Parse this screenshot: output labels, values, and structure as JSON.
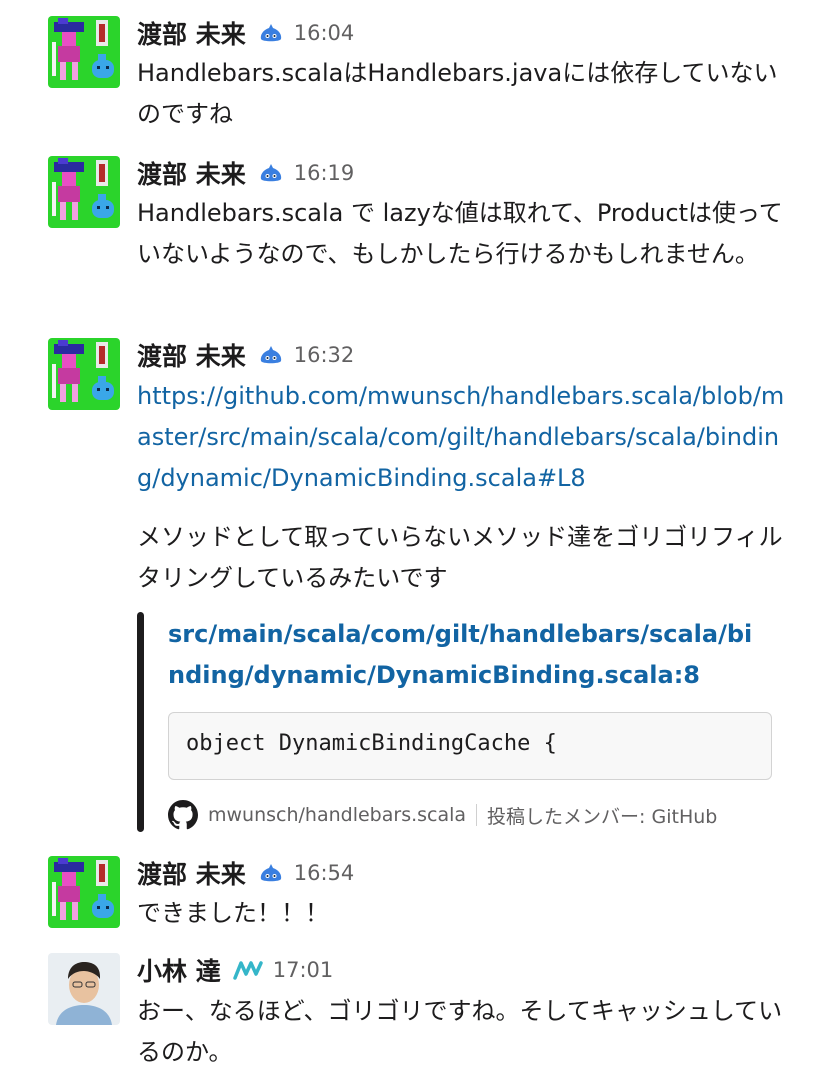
{
  "messages": [
    {
      "user": "渡部 未来",
      "time": "16:04",
      "badge_icon": "slime-icon",
      "text": "Handlebars.scalaはHandlebars.javaには依存していないのですね"
    },
    {
      "user": "渡部 未来",
      "time": "16:19",
      "badge_icon": "slime-icon",
      "text": "Handlebars.scala で lazyな値は取れて、Productは使っていないようなので、もしかしたら行けるかもしれません。"
    },
    {
      "user": "渡部 未来",
      "time": "16:32",
      "badge_icon": "slime-icon",
      "link": "https://github.com/mwunsch/handlebars.scala/blob/master/src/main/scala/com/gilt/handlebars/scala/binding/dynamic/DynamicBinding.scala#L8",
      "text": "メソッドとして取っていらないメソッド達をゴリゴリフィルタリングしているみたいです",
      "attachment": {
        "title": "src/main/scala/com/gilt/handlebars/scala/binding/dynamic/DynamicBinding.scala:8",
        "code": "object DynamicBindingCache {",
        "repo": "mwunsch/handlebars.scala",
        "posted_by": "投稿したメンバー: GitHub",
        "icon": "github-icon"
      }
    },
    {
      "user": "渡部 未来",
      "time": "16:54",
      "badge_icon": "slime-icon",
      "text": "できました！！！"
    },
    {
      "user": "小林 達",
      "time": "17:01",
      "badge_icon": "wave-logo-icon",
      "text": "おー、なるほど、ゴリゴリですね。そしてキャッシュしているのか。"
    }
  ],
  "colors": {
    "link": "#1264a3",
    "avatar_bg": "#2bd42b",
    "timestamp": "#616061",
    "attachment_bar": "#1d1c1d"
  }
}
